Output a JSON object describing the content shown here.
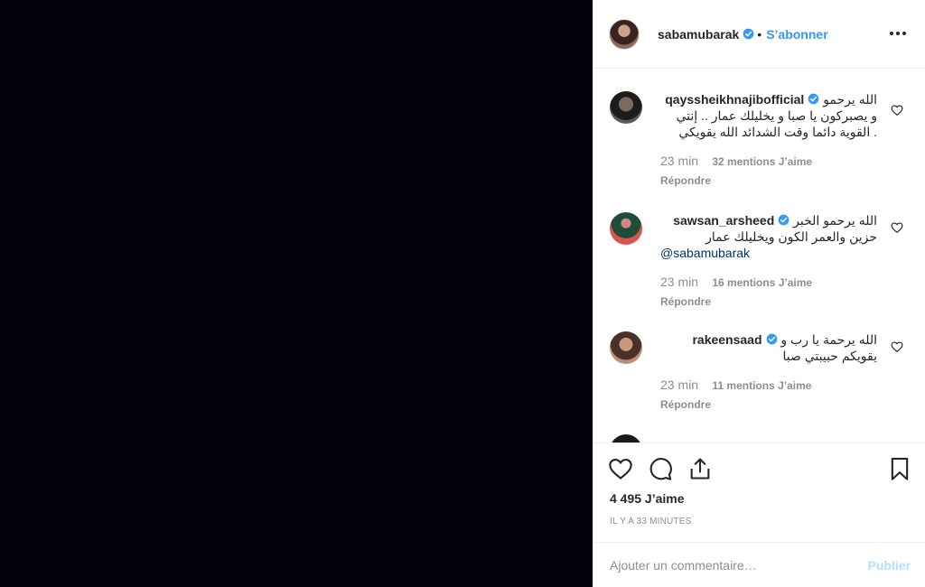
{
  "post": {
    "author": "sabamubarak",
    "separator": "•",
    "follow_label": "S’abonner"
  },
  "comments": [
    {
      "username": "qayssheikhnajibofficial",
      "text": "الله يرحمو و يصبركون يا صبا و يخليلك عمار .. إنتي القوية دائما وقت الشدائد الله يقويكي .",
      "mention": "",
      "time": "23 min",
      "likes": "32 mentions J’aime",
      "reply": "Répondre"
    },
    {
      "username": "sawsan_arsheed",
      "text": "الله يرحمو الخبر حزين والعمر الكون ويخليلك عمار",
      "mention": "@sabamubarak",
      "time": "23 min",
      "likes": "16 mentions J’aime",
      "reply": "Répondre"
    },
    {
      "username": "rakeensaad",
      "text": "الله يرحمة يا رب و يقويكم حبيبتي صبا ",
      "mention": "",
      "time": "23 min",
      "likes": "11 mentions J’aime",
      "reply": "Répondre"
    }
  ],
  "actions": {
    "likes_count": "4 495 J’aime",
    "timestamp": "IL Y A 33 MINUTES"
  },
  "add_comment": {
    "placeholder": "Ajouter un commentaire…",
    "publish_label": "Publier"
  },
  "icons": {
    "like": "heart-icon",
    "comment": "comment-icon",
    "share": "share-icon",
    "save": "bookmark-icon",
    "more": "more-horizontal-icon",
    "verified": "verified-badge-icon"
  },
  "colors": {
    "link": "#3897f0",
    "mention": "#003569",
    "muted": "#8e8e8e",
    "publish_disabled": "#b2dffc",
    "media_bg": "#03030b"
  }
}
